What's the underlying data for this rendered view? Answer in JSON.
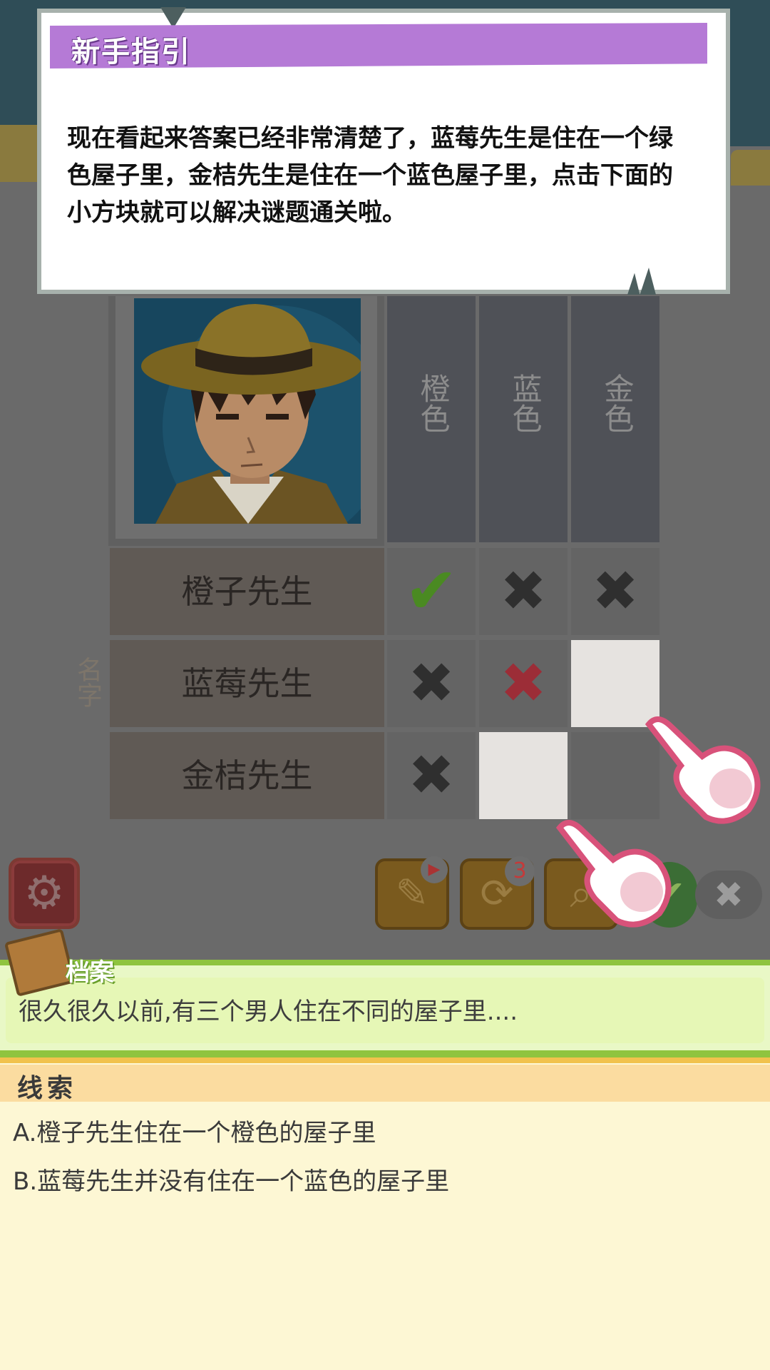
{
  "guide": {
    "title": "新手指引",
    "text": "现在看起来答案已经非常清楚了，蓝莓先生是住在一个绿色屋子里，金桔先生是住在一个蓝色屋子里，点击下面的小方块就可以解决谜题通关啦。"
  },
  "puzzle": {
    "columns": [
      "橙色",
      "蓝色",
      "金色"
    ],
    "row_label": "名字",
    "rows": [
      {
        "name": "橙子先生",
        "marks": [
          "check",
          "x",
          "x"
        ]
      },
      {
        "name": "蓝莓先生",
        "marks": [
          "x",
          "x-red",
          "empty-highlight"
        ]
      },
      {
        "name": "金桔先生",
        "marks": [
          "x",
          "empty-highlight",
          "empty"
        ]
      }
    ]
  },
  "toolbar": {
    "settings_icon": "gear-icon",
    "notes_icon": "notepad-icon",
    "video_badge_icon": "video-icon",
    "refresh_icon": "refresh-icon",
    "refresh_count": "3",
    "hint_icon": "magnifier-icon",
    "confirm_icon": "check-icon",
    "cancel_icon": "close-icon"
  },
  "archive": {
    "title": "档案",
    "text": "很久很久以前,有三个男人住在不同的屋子里...."
  },
  "clues": {
    "title": "线索",
    "items": [
      "A.橙子先生住在一个橙色的屋子里",
      "B.蓝莓先生并没有住在一个蓝色的屋子里"
    ]
  },
  "colors": {
    "guide_tab": "#b57ad6",
    "archive_green": "#8fc43f",
    "clue_header": "#fbdca0",
    "check_green": "#4a8a22",
    "x_red": "#9c2d37"
  }
}
